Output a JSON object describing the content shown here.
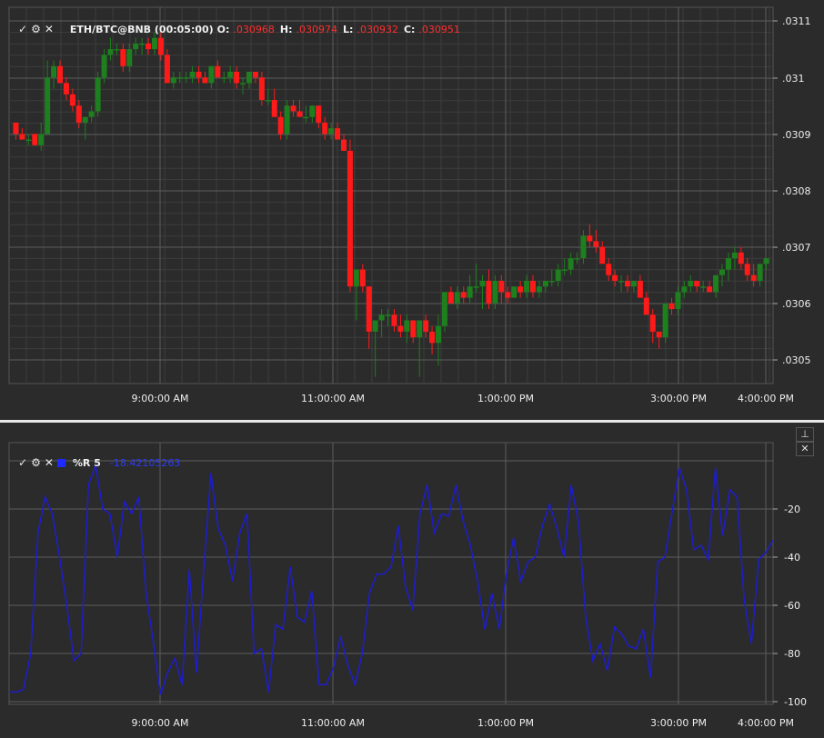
{
  "top_panel": {
    "symbol": "ETH/BTC@BNB (00:05:00)",
    "o_label": "O:",
    "o_value": ".030968",
    "h_label": "H:",
    "h_value": ".030974",
    "l_label": "L:",
    "l_value": ".030932",
    "c_label": "C:",
    "c_value": ".030951"
  },
  "bottom_panel": {
    "indicator": "%R 5",
    "value": "-18.42105263"
  },
  "icons": {
    "check": "check-icon",
    "gear": "gear-icon",
    "close": "close-icon",
    "pin": "pin-icon"
  },
  "colors": {
    "background": "#2b2b2b",
    "grid": "#4f4f4f",
    "up": "#1e7f1e",
    "down": "#ff1a1a",
    "line": "#1d1dd0",
    "separator": "#e9e9e9"
  },
  "chart_data": [
    {
      "type": "candlestick",
      "title": "ETH/BTC@BNB (00:05:00)",
      "x_tick_labels": [
        "9:00:00 AM",
        "11:00:00 AM",
        "1:00:00 PM",
        "3:00:00 PM",
        "4:00:00 PM"
      ],
      "y_tick_labels": [
        ".0311",
        ".031",
        ".0309",
        ".0308",
        ".0307",
        ".0306",
        ".0305"
      ],
      "ylim": [
        0.03046,
        0.03112
      ],
      "grid": true,
      "candles": [
        [
          0.03092,
          0.03092,
          0.03089,
          0.0309
        ],
        [
          0.0309,
          0.03091,
          0.03089,
          0.03089
        ],
        [
          0.03089,
          0.0309,
          0.03088,
          0.03089
        ],
        [
          0.0309,
          0.0309,
          0.03088,
          0.03088
        ],
        [
          0.03088,
          0.03092,
          0.03087,
          0.0309
        ],
        [
          0.0309,
          0.03103,
          0.0309,
          0.031
        ],
        [
          0.031,
          0.03103,
          0.03098,
          0.03102
        ],
        [
          0.03102,
          0.03103,
          0.03099,
          0.03099
        ],
        [
          0.03099,
          0.031,
          0.03096,
          0.03097
        ],
        [
          0.03097,
          0.03098,
          0.03094,
          0.03095
        ],
        [
          0.03095,
          0.03096,
          0.03091,
          0.03092
        ],
        [
          0.03092,
          0.03093,
          0.03089,
          0.03093
        ],
        [
          0.03093,
          0.03095,
          0.03092,
          0.03094
        ],
        [
          0.03094,
          0.03101,
          0.03093,
          0.031
        ],
        [
          0.031,
          0.03105,
          0.03099,
          0.03104
        ],
        [
          0.03104,
          0.03107,
          0.03103,
          0.03105
        ],
        [
          0.03105,
          0.03106,
          0.03104,
          0.03105
        ],
        [
          0.03105,
          0.03106,
          0.03101,
          0.03102
        ],
        [
          0.03102,
          0.03106,
          0.03101,
          0.03105
        ],
        [
          0.03105,
          0.03107,
          0.03104,
          0.03106
        ],
        [
          0.03106,
          0.03107,
          0.03104,
          0.03106
        ],
        [
          0.03106,
          0.03107,
          0.03104,
          0.03105
        ],
        [
          0.03105,
          0.03108,
          0.03104,
          0.03107
        ],
        [
          0.03107,
          0.03108,
          0.03103,
          0.03104
        ],
        [
          0.03104,
          0.03105,
          0.03099,
          0.03099
        ],
        [
          0.03099,
          0.03101,
          0.03098,
          0.031
        ],
        [
          0.031,
          0.03101,
          0.03099,
          0.031
        ],
        [
          0.031,
          0.03101,
          0.03099,
          0.031
        ],
        [
          0.031,
          0.03102,
          0.03099,
          0.03101
        ],
        [
          0.03101,
          0.03102,
          0.03099,
          0.031
        ],
        [
          0.031,
          0.03101,
          0.03099,
          0.03099
        ],
        [
          0.03099,
          0.03102,
          0.03098,
          0.03102
        ],
        [
          0.03102,
          0.03103,
          0.031,
          0.031
        ],
        [
          0.031,
          0.03101,
          0.03099,
          0.031
        ],
        [
          0.031,
          0.03102,
          0.03099,
          0.03101
        ],
        [
          0.03101,
          0.03102,
          0.03098,
          0.03099
        ],
        [
          0.03099,
          0.031,
          0.03097,
          0.03099
        ],
        [
          0.03099,
          0.03101,
          0.03098,
          0.03101
        ],
        [
          0.03101,
          0.03101,
          0.03099,
          0.031
        ],
        [
          0.031,
          0.03101,
          0.03095,
          0.03096
        ],
        [
          0.03096,
          0.03098,
          0.03095,
          0.03096
        ],
        [
          0.03096,
          0.03098,
          0.03093,
          0.03093
        ],
        [
          0.03093,
          0.03094,
          0.03089,
          0.0309
        ],
        [
          0.0309,
          0.03096,
          0.03089,
          0.03095
        ],
        [
          0.03095,
          0.03096,
          0.03093,
          0.03094
        ],
        [
          0.03094,
          0.03096,
          0.03093,
          0.03093
        ],
        [
          0.03093,
          0.03095,
          0.03092,
          0.03093
        ],
        [
          0.03093,
          0.03095,
          0.03092,
          0.03095
        ],
        [
          0.03095,
          0.03095,
          0.03091,
          0.03092
        ],
        [
          0.03092,
          0.03093,
          0.03089,
          0.0309
        ],
        [
          0.0309,
          0.03092,
          0.03089,
          0.03091
        ],
        [
          0.03091,
          0.03092,
          0.03089,
          0.03089
        ],
        [
          0.03089,
          0.0309,
          0.03087,
          0.03087
        ],
        [
          0.03087,
          0.03089,
          0.03062,
          0.03063
        ],
        [
          0.03063,
          0.03064,
          0.03057,
          0.03066
        ],
        [
          0.03066,
          0.03067,
          0.03062,
          0.03063
        ],
        [
          0.03063,
          0.03063,
          0.03052,
          0.03055
        ],
        [
          0.03055,
          0.03057,
          0.03047,
          0.03057
        ],
        [
          0.03057,
          0.03059,
          0.03054,
          0.03058
        ],
        [
          0.03058,
          0.03059,
          0.03056,
          0.03058
        ],
        [
          0.03058,
          0.03059,
          0.03055,
          0.03056
        ],
        [
          0.03056,
          0.03058,
          0.03054,
          0.03055
        ],
        [
          0.03055,
          0.03058,
          0.03053,
          0.03057
        ],
        [
          0.03057,
          0.03057,
          0.03053,
          0.03054
        ],
        [
          0.03054,
          0.03057,
          0.03047,
          0.03057
        ],
        [
          0.03057,
          0.03058,
          0.03054,
          0.03055
        ],
        [
          0.03055,
          0.03056,
          0.03051,
          0.03053
        ],
        [
          0.03053,
          0.03058,
          0.03049,
          0.03056
        ],
        [
          0.03056,
          0.03062,
          0.03055,
          0.03062
        ],
        [
          0.03062,
          0.03063,
          0.0306,
          0.0306
        ],
        [
          0.0306,
          0.03063,
          0.03059,
          0.03062
        ],
        [
          0.03062,
          0.03063,
          0.0306,
          0.03061
        ],
        [
          0.03061,
          0.03065,
          0.0306,
          0.03063
        ],
        [
          0.03063,
          0.03067,
          0.03062,
          0.03063
        ],
        [
          0.03063,
          0.03065,
          0.03059,
          0.03064
        ],
        [
          0.03064,
          0.03066,
          0.03059,
          0.0306
        ],
        [
          0.0306,
          0.03065,
          0.03059,
          0.03064
        ],
        [
          0.03064,
          0.03065,
          0.0306,
          0.03062
        ],
        [
          0.03062,
          0.03063,
          0.0306,
          0.03061
        ],
        [
          0.03061,
          0.03063,
          0.03061,
          0.03063
        ],
        [
          0.03063,
          0.03064,
          0.03061,
          0.03062
        ],
        [
          0.03062,
          0.03065,
          0.03061,
          0.03064
        ],
        [
          0.03064,
          0.03065,
          0.03061,
          0.03062
        ],
        [
          0.03062,
          0.03064,
          0.03061,
          0.03063
        ],
        [
          0.03063,
          0.03064,
          0.03062,
          0.03064
        ],
        [
          0.03064,
          0.03066,
          0.03063,
          0.03064
        ],
        [
          0.03064,
          0.03067,
          0.03063,
          0.03066
        ],
        [
          0.03066,
          0.03068,
          0.03065,
          0.03066
        ],
        [
          0.03066,
          0.03069,
          0.03065,
          0.03068
        ],
        [
          0.03068,
          0.03069,
          0.03067,
          0.03068
        ],
        [
          0.03068,
          0.03073,
          0.03067,
          0.03072
        ],
        [
          0.03072,
          0.03074,
          0.0307,
          0.03071
        ],
        [
          0.03071,
          0.03073,
          0.03069,
          0.0307
        ],
        [
          0.0307,
          0.03071,
          0.03067,
          0.03067
        ],
        [
          0.03067,
          0.03068,
          0.03064,
          0.03065
        ],
        [
          0.03065,
          0.03066,
          0.03063,
          0.03064
        ],
        [
          0.03064,
          0.03065,
          0.03062,
          0.03064
        ],
        [
          0.03064,
          0.03065,
          0.03062,
          0.03063
        ],
        [
          0.03063,
          0.03064,
          0.03062,
          0.03064
        ],
        [
          0.03064,
          0.03065,
          0.03061,
          0.03061
        ],
        [
          0.03061,
          0.03062,
          0.03058,
          0.03058
        ],
        [
          0.03058,
          0.03059,
          0.03053,
          0.03055
        ],
        [
          0.03055,
          0.03055,
          0.03052,
          0.03054
        ],
        [
          0.03054,
          0.0306,
          0.03053,
          0.0306
        ],
        [
          0.0306,
          0.03061,
          0.03058,
          0.03059
        ],
        [
          0.03059,
          0.03063,
          0.03058,
          0.03062
        ],
        [
          0.03062,
          0.03064,
          0.03061,
          0.03063
        ],
        [
          0.03063,
          0.03065,
          0.03062,
          0.03064
        ],
        [
          0.03064,
          0.03064,
          0.03062,
          0.03063
        ],
        [
          0.03063,
          0.03064,
          0.03062,
          0.03063
        ],
        [
          0.03063,
          0.03064,
          0.03062,
          0.03062
        ],
        [
          0.03062,
          0.03065,
          0.03061,
          0.03065
        ],
        [
          0.03065,
          0.03067,
          0.03063,
          0.03066
        ],
        [
          0.03066,
          0.03069,
          0.03064,
          0.03068
        ],
        [
          0.03068,
          0.0307,
          0.03066,
          0.03069
        ],
        [
          0.03069,
          0.0307,
          0.03066,
          0.03067
        ],
        [
          0.03067,
          0.03068,
          0.03064,
          0.03065
        ],
        [
          0.03065,
          0.03067,
          0.03063,
          0.03064
        ],
        [
          0.03064,
          0.03067,
          0.03063,
          0.03067
        ],
        [
          0.03067,
          0.03068,
          0.03066,
          0.03068
        ]
      ]
    },
    {
      "type": "line",
      "title": "%R 5",
      "x_tick_labels": [
        "9:00:00 AM",
        "11:00:00 AM",
        "1:00:00 PM",
        "3:00:00 PM",
        "4:00:00 PM"
      ],
      "y_tick_labels": [
        "-20",
        "-40",
        "-60",
        "-80",
        "-100"
      ],
      "ylim": [
        -101,
        2
      ],
      "grid": true,
      "series": [
        {
          "values": [
            -96,
            -96,
            -95,
            -80,
            -30,
            -15,
            -22,
            -40,
            -60,
            -83,
            -80,
            -10,
            -2,
            -20,
            -22,
            -40,
            -17,
            -22,
            -15,
            -55,
            -75,
            -97,
            -88,
            -82,
            -93,
            -45,
            -88,
            -45,
            -5,
            -28,
            -35,
            -50,
            -30,
            -22,
            -80,
            -78,
            -96,
            -68,
            -70,
            -44,
            -65,
            -67,
            -54,
            -93,
            -93,
            -86,
            -73,
            -85,
            -93,
            -80,
            -55,
            -47,
            -47,
            -44,
            -27,
            -52,
            -62,
            -22,
            -10,
            -30,
            -22,
            -23,
            -10,
            -25,
            -35,
            -50,
            -70,
            -55,
            -70,
            -47,
            -32,
            -50,
            -42,
            -40,
            -27,
            -18,
            -28,
            -40,
            -10,
            -25,
            -65,
            -83,
            -76,
            -87,
            -69,
            -72,
            -77,
            -78,
            -70,
            -90,
            -42,
            -40,
            -21,
            -3,
            -12,
            -37,
            -35,
            -41,
            -3,
            -31,
            -12,
            -15,
            -58,
            -76,
            -41,
            -38,
            -33
          ]
        }
      ]
    }
  ]
}
